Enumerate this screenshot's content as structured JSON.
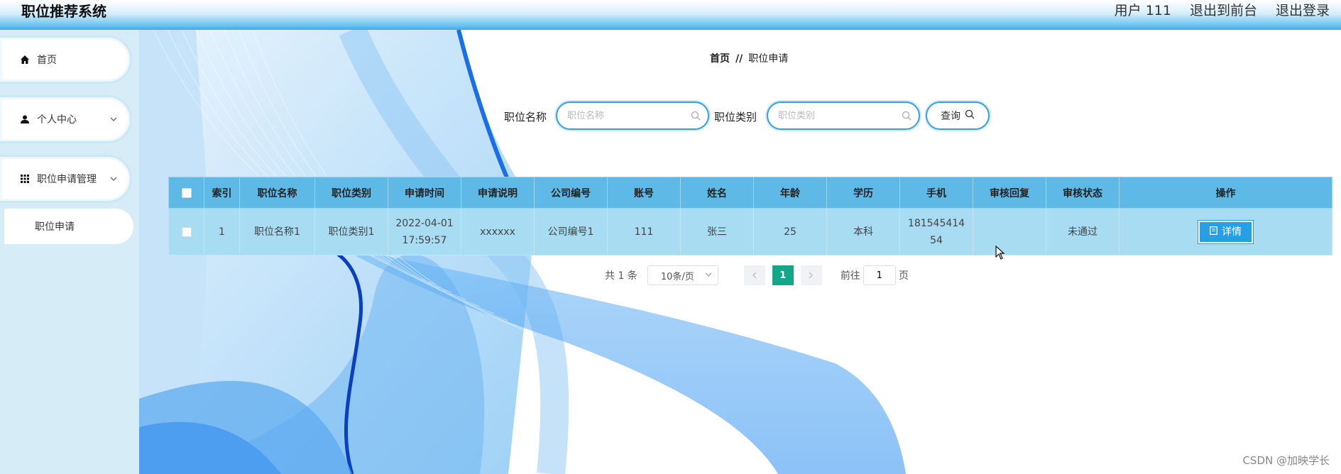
{
  "header": {
    "title": "职位推荐系统",
    "user_label": "用户 111",
    "to_frontend": "退出到前台",
    "logout": "退出登录"
  },
  "sidebar": {
    "items": [
      {
        "label": "首页",
        "icon": "home-icon"
      },
      {
        "label": "个人中心",
        "icon": "user-icon"
      },
      {
        "label": "职位申请管理",
        "icon": "grid-icon"
      }
    ],
    "sub_item": "职位申请"
  },
  "breadcrumb": {
    "home": "首页",
    "sep": "//",
    "current": "职位申请"
  },
  "search": {
    "name_label": "职位名称",
    "name_placeholder": "职位名称",
    "category_label": "职位类别",
    "category_placeholder": "职位类别",
    "query_label": "查询"
  },
  "table": {
    "headers": [
      "索引",
      "职位名称",
      "职位类别",
      "申请时间",
      "申请说明",
      "公司编号",
      "账号",
      "姓名",
      "年龄",
      "学历",
      "手机",
      "审核回复",
      "审核状态",
      "操作"
    ],
    "rows": [
      {
        "index": "1",
        "job_name": "职位名称1",
        "job_category": "职位类别1",
        "apply_date": "2022-04-01",
        "apply_time": "17:59:57",
        "apply_note": "xxxxxx",
        "company_no": "公司编号1",
        "account": "111",
        "name": "张三",
        "age": "25",
        "education": "本科",
        "phone_line1": "181545414",
        "phone_line2": "54",
        "review_reply": "",
        "review_status": "未通过",
        "action_label": "详情"
      }
    ]
  },
  "pager": {
    "total": "共 1 条",
    "page_size": "10条/页",
    "current_page": "1",
    "goto_label": "前往",
    "goto_value": "1",
    "page_suffix": "页"
  },
  "watermark": "CSDN @加映学长",
  "colors": {
    "header_accent": "#3ea9ea",
    "table_header": "#5fb9e6",
    "table_row": "#a8dcf2",
    "primary_button": "#279fe6",
    "pager_active": "#14a689"
  }
}
